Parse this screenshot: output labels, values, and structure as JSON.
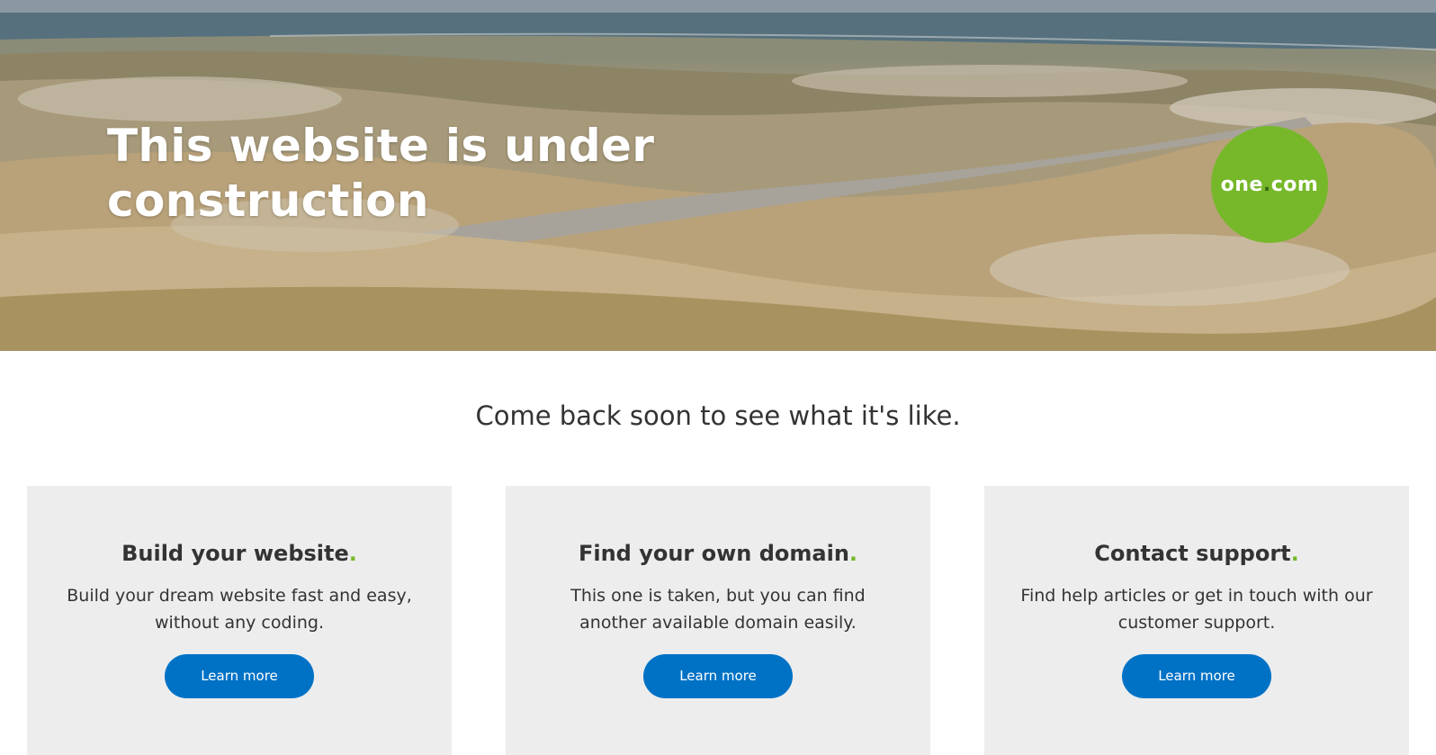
{
  "hero": {
    "title": "This website is under construction"
  },
  "logo": {
    "text_before": "one",
    "dot": ".",
    "text_after": "com",
    "color": "#76b82a"
  },
  "tagline": "Come back soon to see what it's like.",
  "cards": [
    {
      "title": "Build your website",
      "accent": ".",
      "description": "Build your dream website fast and easy, without any coding.",
      "button_label": "Learn more"
    },
    {
      "title": "Find your own domain",
      "accent": ".",
      "description": "This one is taken, but you can find another available domain easily.",
      "button_label": "Learn more"
    },
    {
      "title": "Contact support",
      "accent": ".",
      "description": "Find help articles or get in touch with our customer support.",
      "button_label": "Learn more"
    }
  ],
  "colors": {
    "accent_green": "#76b82a",
    "button_blue": "#0072c6",
    "card_background": "#ededed",
    "text": "#333333"
  }
}
